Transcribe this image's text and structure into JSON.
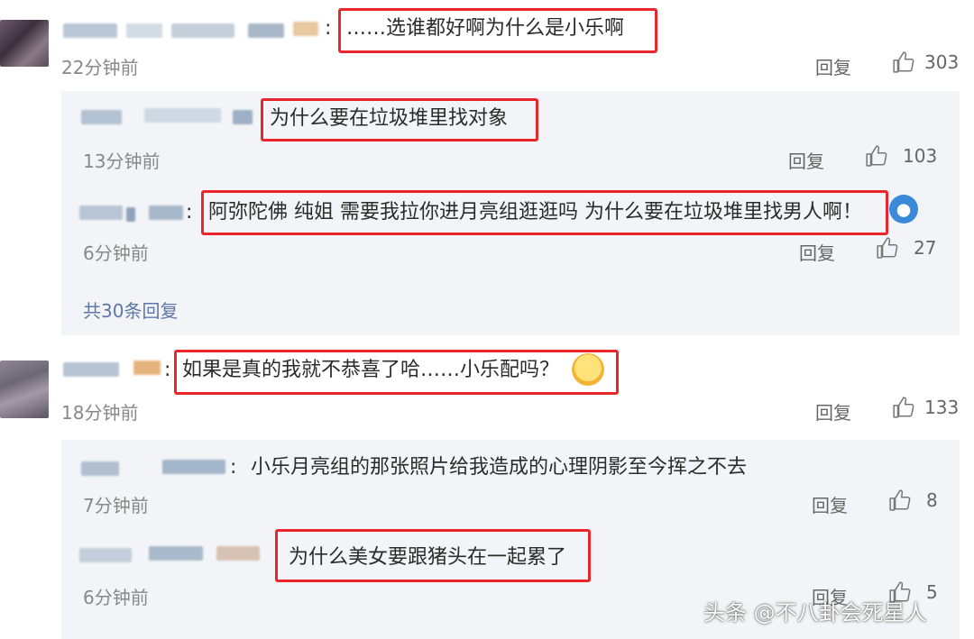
{
  "comments": [
    {
      "text": "……选谁都好啊为什么是小乐啊",
      "time": "22分钟前",
      "reply_label": "回复",
      "likes": "303",
      "replies": [
        {
          "text": "为什么要在垃圾堆里找对象",
          "time": "13分钟前",
          "reply_label": "回复",
          "likes": "103"
        },
        {
          "text": "阿弥陀佛 纯姐 需要我拉你进月亮组逛逛吗 为什么要在垃圾堆里找男人啊！",
          "time": "6分钟前",
          "reply_label": "回复",
          "likes": "27"
        }
      ],
      "more_replies": "共30条回复"
    },
    {
      "text": "如果是真的我就不恭喜了哈……小乐配吗？",
      "time": "18分钟前",
      "reply_label": "回复",
      "likes": "133",
      "replies": [
        {
          "text": "小乐月亮组的那张照片给我造成的心理阴影至今挥之不去",
          "time": "7分钟前",
          "reply_label": "回复",
          "likes": "8"
        },
        {
          "text": "为什么美女要跟猪头在一起累了",
          "time": "6分钟前",
          "reply_label": "回复",
          "likes": "5"
        }
      ]
    }
  ],
  "watermark": "头条 @不八卦会死星人",
  "colors": {
    "highlight": "#e8262b",
    "link": "#5d77a8",
    "panel": "#f3f4f7"
  }
}
